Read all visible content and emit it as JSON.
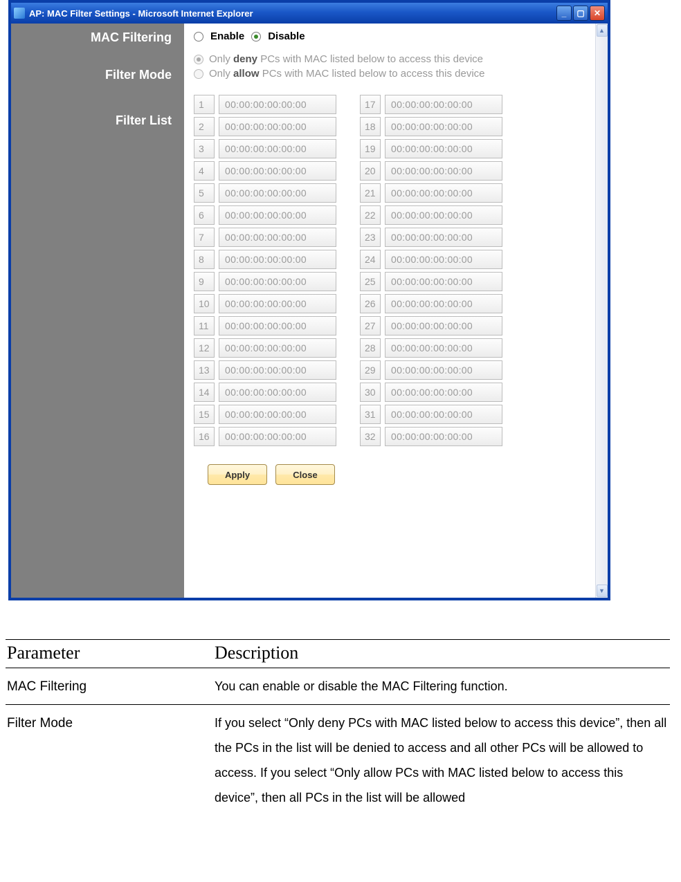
{
  "window": {
    "title": "AP: MAC Filter Settings - Microsoft Internet Explorer"
  },
  "labels": {
    "mac_filtering": "MAC Filtering",
    "filter_mode": "Filter Mode",
    "filter_list": "Filter List"
  },
  "mac_filtering": {
    "enable_label": "Enable",
    "disable_label": "Disable",
    "selected": "disable"
  },
  "filter_mode": {
    "deny_prefix": "Only ",
    "deny_bold": "deny",
    "deny_suffix": " PCs with MAC listed below to access this device",
    "allow_prefix": "Only ",
    "allow_bold": "allow",
    "allow_suffix": " PCs with MAC listed below to access this device",
    "selected": "deny"
  },
  "filter_list": {
    "col1": [
      {
        "idx": "1",
        "mac": "00:00:00:00:00:00"
      },
      {
        "idx": "2",
        "mac": "00:00:00:00:00:00"
      },
      {
        "idx": "3",
        "mac": "00:00:00:00:00:00"
      },
      {
        "idx": "4",
        "mac": "00:00:00:00:00:00"
      },
      {
        "idx": "5",
        "mac": "00:00:00:00:00:00"
      },
      {
        "idx": "6",
        "mac": "00:00:00:00:00:00"
      },
      {
        "idx": "7",
        "mac": "00:00:00:00:00:00"
      },
      {
        "idx": "8",
        "mac": "00:00:00:00:00:00"
      },
      {
        "idx": "9",
        "mac": "00:00:00:00:00:00"
      },
      {
        "idx": "10",
        "mac": "00:00:00:00:00:00"
      },
      {
        "idx": "11",
        "mac": "00:00:00:00:00:00"
      },
      {
        "idx": "12",
        "mac": "00:00:00:00:00:00"
      },
      {
        "idx": "13",
        "mac": "00:00:00:00:00:00"
      },
      {
        "idx": "14",
        "mac": "00:00:00:00:00:00"
      },
      {
        "idx": "15",
        "mac": "00:00:00:00:00:00"
      },
      {
        "idx": "16",
        "mac": "00:00:00:00:00:00"
      }
    ],
    "col2": [
      {
        "idx": "17",
        "mac": "00:00:00:00:00:00"
      },
      {
        "idx": "18",
        "mac": "00:00:00:00:00:00"
      },
      {
        "idx": "19",
        "mac": "00:00:00:00:00:00"
      },
      {
        "idx": "20",
        "mac": "00:00:00:00:00:00"
      },
      {
        "idx": "21",
        "mac": "00:00:00:00:00:00"
      },
      {
        "idx": "22",
        "mac": "00:00:00:00:00:00"
      },
      {
        "idx": "23",
        "mac": "00:00:00:00:00:00"
      },
      {
        "idx": "24",
        "mac": "00:00:00:00:00:00"
      },
      {
        "idx": "25",
        "mac": "00:00:00:00:00:00"
      },
      {
        "idx": "26",
        "mac": "00:00:00:00:00:00"
      },
      {
        "idx": "27",
        "mac": "00:00:00:00:00:00"
      },
      {
        "idx": "28",
        "mac": "00:00:00:00:00:00"
      },
      {
        "idx": "29",
        "mac": "00:00:00:00:00:00"
      },
      {
        "idx": "30",
        "mac": "00:00:00:00:00:00"
      },
      {
        "idx": "31",
        "mac": "00:00:00:00:00:00"
      },
      {
        "idx": "32",
        "mac": "00:00:00:00:00:00"
      }
    ]
  },
  "buttons": {
    "apply": "Apply",
    "close": "Close"
  },
  "doc_table": {
    "header_param": "Parameter",
    "header_desc": "Description",
    "rows": [
      {
        "param": "MAC Filtering",
        "desc": "You can enable or disable the MAC Filtering function."
      },
      {
        "param": "Filter Mode",
        "desc": "If you select “Only deny PCs with MAC listed below to access this device”, then all the PCs in the list will be denied to access and all other PCs will be allowed to access. If you select “Only allow PCs with MAC listed below to access this device”, then all PCs in the list will be allowed"
      }
    ]
  }
}
